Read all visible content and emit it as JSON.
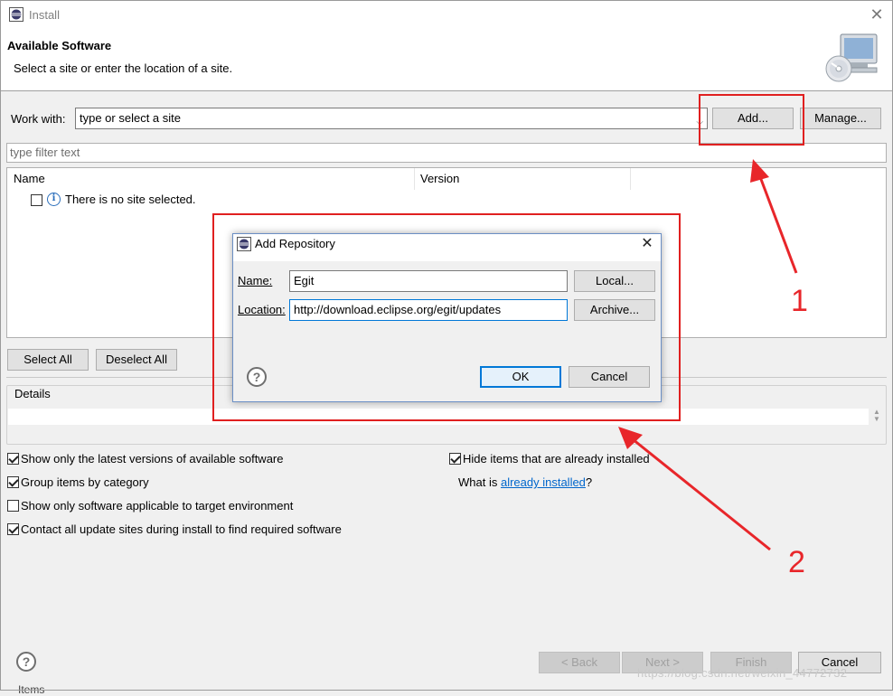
{
  "window": {
    "title": "Install"
  },
  "banner": {
    "title": "Available Software",
    "subtitle": "Select a site or enter the location of a site."
  },
  "work_with": {
    "label": "Work with:",
    "value": "type or select a site",
    "add_label": "Add...",
    "manage_label": "Manage..."
  },
  "filter": {
    "placeholder": "type filter text"
  },
  "table": {
    "columns": [
      "Name",
      "Version"
    ],
    "rows": [
      {
        "checked": false,
        "text": "There is no site selected."
      }
    ]
  },
  "buttons": {
    "select_all": "Select All",
    "deselect_all": "Deselect All"
  },
  "details": {
    "label": "Details"
  },
  "options": {
    "show_latest": "Show only the latest versions of available software",
    "group_by_category": "Group items by category",
    "show_applicable": "Show only software applicable to target environment",
    "contact_all": "Contact all update sites during install to find required software",
    "hide_installed": "Hide items that are already installed",
    "what_is_prefix": "What is ",
    "what_is_link": "already installed",
    "what_is_suffix": "?"
  },
  "footer": {
    "back": "< Back",
    "next": "Next >",
    "finish": "Finish",
    "cancel": "Cancel",
    "bottom_text": "Items"
  },
  "dialog": {
    "title": "Add Repository",
    "name_label": "Name:",
    "name_value": "Egit",
    "location_label": "Location:",
    "location_value": "http://download.eclipse.org/egit/updates",
    "local_label": "Local...",
    "archive_label": "Archive...",
    "ok_label": "OK",
    "cancel_label": "Cancel"
  },
  "annotations": {
    "one": "1",
    "two": "2",
    "color": "#e02020"
  },
  "watermark": "https://blog.csdn.net/weixin_44772732",
  "icons": {
    "app": "eclipse-icon",
    "banner": "computer-cd-icon",
    "close": "close-icon",
    "info": "info-icon",
    "help": "help-icon"
  }
}
